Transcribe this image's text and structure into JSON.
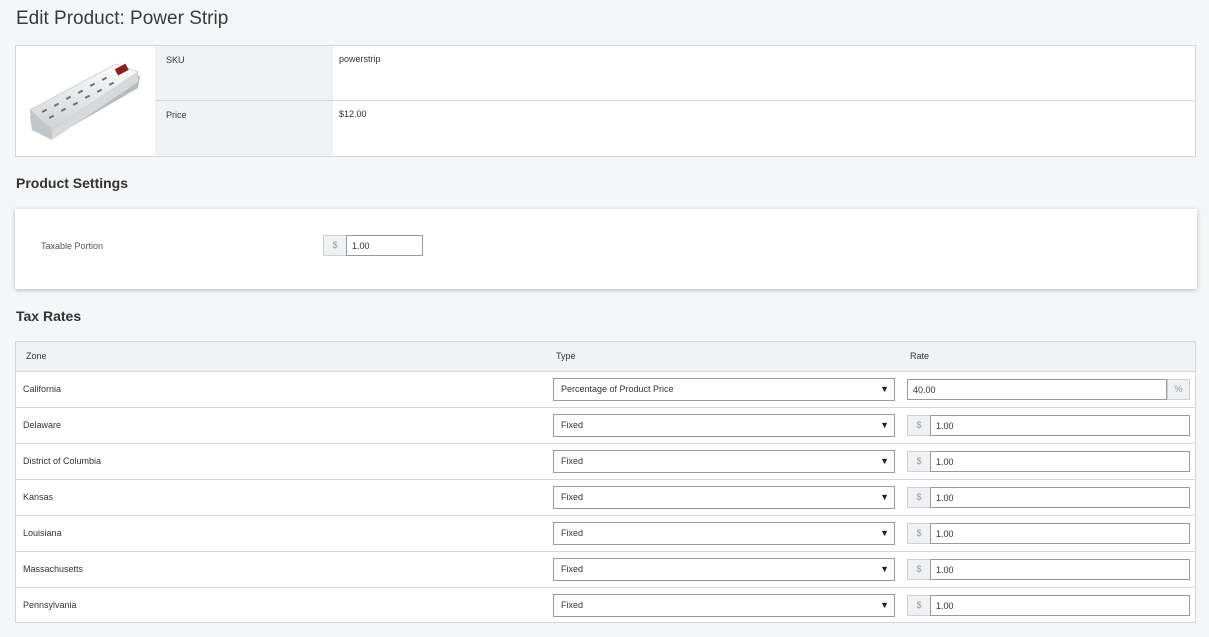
{
  "page": {
    "title": "Edit Product: Power Strip"
  },
  "summary": {
    "image_icon": "power-strip-image",
    "sku_label": "SKU",
    "sku_value": "powerstrip",
    "price_label": "Price",
    "price_value": "$12.00"
  },
  "settings": {
    "title": "Product Settings",
    "taxable_label": "Taxable Portion",
    "taxable_prefix": "$",
    "taxable_value": "1.00"
  },
  "tax_rates": {
    "title": "Tax Rates",
    "headers": {
      "zone": "Zone",
      "type": "Type",
      "rate": "Rate"
    },
    "rows": [
      {
        "zone": "California",
        "type": "Percentage of Product Price",
        "rate": "40.00",
        "unit": "%",
        "unit_side": "right"
      },
      {
        "zone": "Delaware",
        "type": "Fixed",
        "rate": "1.00",
        "unit": "$",
        "unit_side": "left"
      },
      {
        "zone": "District of Columbia",
        "type": "Fixed",
        "rate": "1.00",
        "unit": "$",
        "unit_side": "left"
      },
      {
        "zone": "Kansas",
        "type": "Fixed",
        "rate": "1.00",
        "unit": "$",
        "unit_side": "left"
      },
      {
        "zone": "Louisiana",
        "type": "Fixed",
        "rate": "1.00",
        "unit": "$",
        "unit_side": "left"
      },
      {
        "zone": "Massachusetts",
        "type": "Fixed",
        "rate": "1.00",
        "unit": "$",
        "unit_side": "left"
      },
      {
        "zone": "Pennsylvania",
        "type": "Fixed",
        "rate": "1.00",
        "unit": "$",
        "unit_side": "left"
      }
    ]
  },
  "icons": {
    "dropdown": "chevron-down-icon"
  },
  "colors": {
    "background": "#f5f6f7",
    "border": "#d6d6d6",
    "header_bg": "#f1f2f3"
  }
}
